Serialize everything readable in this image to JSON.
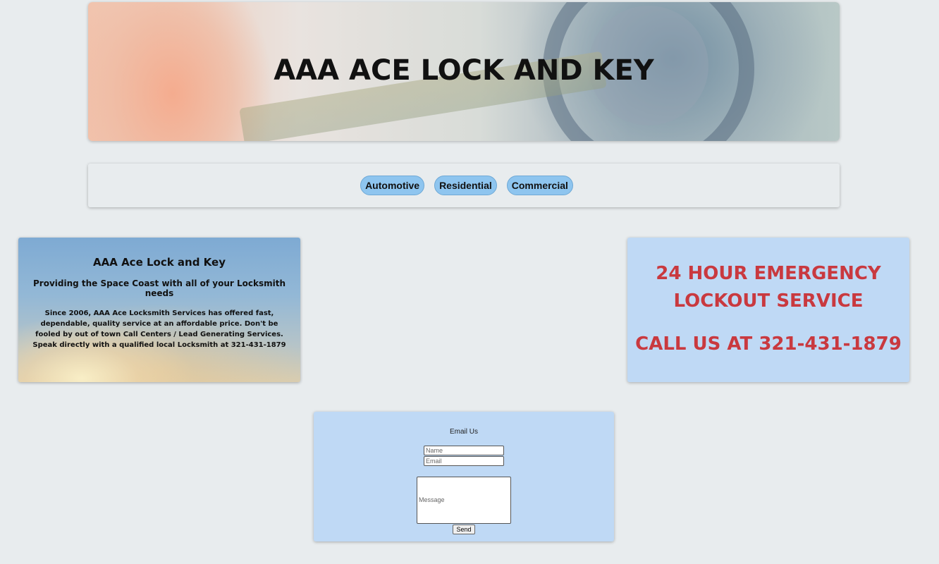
{
  "header": {
    "title": "AAA ACE LOCK AND KEY"
  },
  "nav": {
    "items": [
      {
        "label": "Automotive"
      },
      {
        "label": "Residential"
      },
      {
        "label": "Commercial"
      }
    ]
  },
  "about": {
    "heading": "AAA Ace Lock and Key",
    "subheading": "Providing the Space Coast with all of your Locksmith needs",
    "body": "Since 2006, AAA Ace Locksmith Services has offered fast, dependable, quality service at an affordable price. Don't be fooled by out of town Call Centers / Lead Generating Services. Speak directly with a qualified local Locksmith at 321-431-1879"
  },
  "emergency": {
    "line1": "24 HOUR EMERGENCY",
    "line2": "LOCKOUT SERVICE",
    "phone_line": "CALL US AT 321-431-1879",
    "text_color": "#c9393f",
    "background": "#bfd9f5"
  },
  "contact": {
    "title": "Email Us",
    "name_placeholder": "Name",
    "email_placeholder": "Email",
    "message_placeholder": "Message",
    "send_label": "Send"
  },
  "colors": {
    "page_background": "#e8ecee",
    "nav_button": "#8ec5ef",
    "card_background": "#bfd9f5"
  }
}
